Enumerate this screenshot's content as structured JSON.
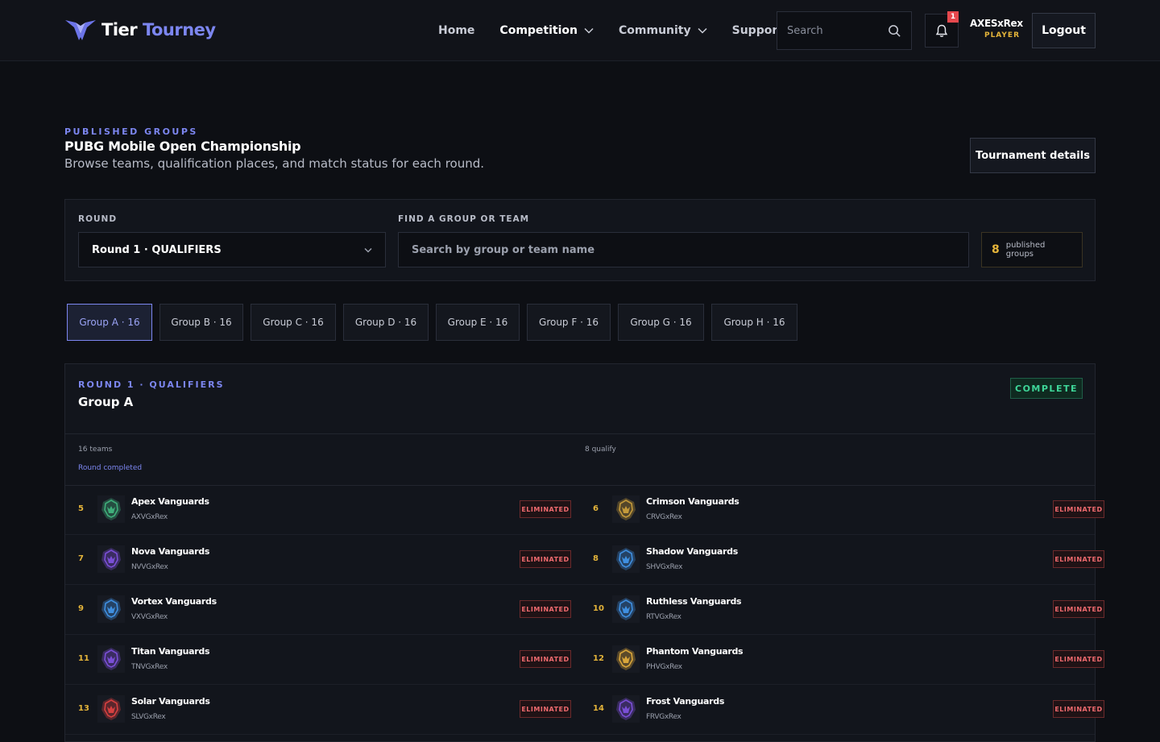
{
  "brand": {
    "name_part1": "Tier",
    "name_part2": "Tourney"
  },
  "nav": [
    {
      "label": "Home",
      "strong": false,
      "dropdown": false
    },
    {
      "label": "Competition",
      "strong": true,
      "dropdown": true
    },
    {
      "label": "Community",
      "strong": false,
      "dropdown": true
    },
    {
      "label": "Support",
      "strong": false,
      "dropdown": false
    }
  ],
  "header": {
    "search_placeholder": "Search",
    "notification_count": "1",
    "user_name": "AXESxRex",
    "user_role": "PLAYER",
    "logout_label": "Logout"
  },
  "page": {
    "eyebrow": "PUBLISHED GROUPS",
    "title": "PUBG Mobile Open Championship",
    "subtitle": "Browse teams, qualification places, and match status for each round.",
    "details_button": "Tournament details"
  },
  "filters": {
    "round_label": "ROUND",
    "round_value": "Round 1 · QUALIFIERS",
    "find_label": "FIND A GROUP OR TEAM",
    "find_placeholder": "Search by group or team name",
    "published_count": "8",
    "published_label": "published groups"
  },
  "tabs": [
    {
      "label": "Group A · 16",
      "active": true
    },
    {
      "label": "Group B · 16",
      "active": false
    },
    {
      "label": "Group C · 16",
      "active": false
    },
    {
      "label": "Group D · 16",
      "active": false
    },
    {
      "label": "Group E · 16",
      "active": false
    },
    {
      "label": "Group F · 16",
      "active": false
    },
    {
      "label": "Group G · 16",
      "active": false
    },
    {
      "label": "Group H · 16",
      "active": false
    }
  ],
  "group": {
    "eyebrow": "ROUND 1 · QUALIFIERS",
    "title": "Group A",
    "status": "COMPLETE",
    "teams_count": "16 teams",
    "qualify_count": "8 qualify",
    "round_status": "Round completed",
    "teams": [
      {
        "rank": "5",
        "name": "Apex Vanguards",
        "tag": "AXVGxRex",
        "status": "ELIMINATED",
        "color": "#3fae7a"
      },
      {
        "rank": "6",
        "name": "Crimson Vanguards",
        "tag": "CRVGxRex",
        "status": "ELIMINATED",
        "color": "#c49a3a"
      },
      {
        "rank": "7",
        "name": "Nova Vanguards",
        "tag": "NVVGxRex",
        "status": "ELIMINATED",
        "color": "#7a4fd6"
      },
      {
        "rank": "8",
        "name": "Shadow Vanguards",
        "tag": "SHVGxRex",
        "status": "ELIMINATED",
        "color": "#3f8fe0"
      },
      {
        "rank": "9",
        "name": "Vortex Vanguards",
        "tag": "VXVGxRex",
        "status": "ELIMINATED",
        "color": "#3f8fe0"
      },
      {
        "rank": "10",
        "name": "Ruthless Vanguards",
        "tag": "RTVGxRex",
        "status": "ELIMINATED",
        "color": "#3f8fe0"
      },
      {
        "rank": "11",
        "name": "Titan Vanguards",
        "tag": "TNVGxRex",
        "status": "ELIMINATED",
        "color": "#7a4fd6"
      },
      {
        "rank": "12",
        "name": "Phantom Vanguards",
        "tag": "PHVGxRex",
        "status": "ELIMINATED",
        "color": "#d9a63a"
      },
      {
        "rank": "13",
        "name": "Solar Vanguards",
        "tag": "SLVGxRex",
        "status": "ELIMINATED",
        "color": "#d64040"
      },
      {
        "rank": "14",
        "name": "Frost Vanguards",
        "tag": "FRVGxRex",
        "status": "ELIMINATED",
        "color": "#7a4fd6"
      }
    ]
  }
}
